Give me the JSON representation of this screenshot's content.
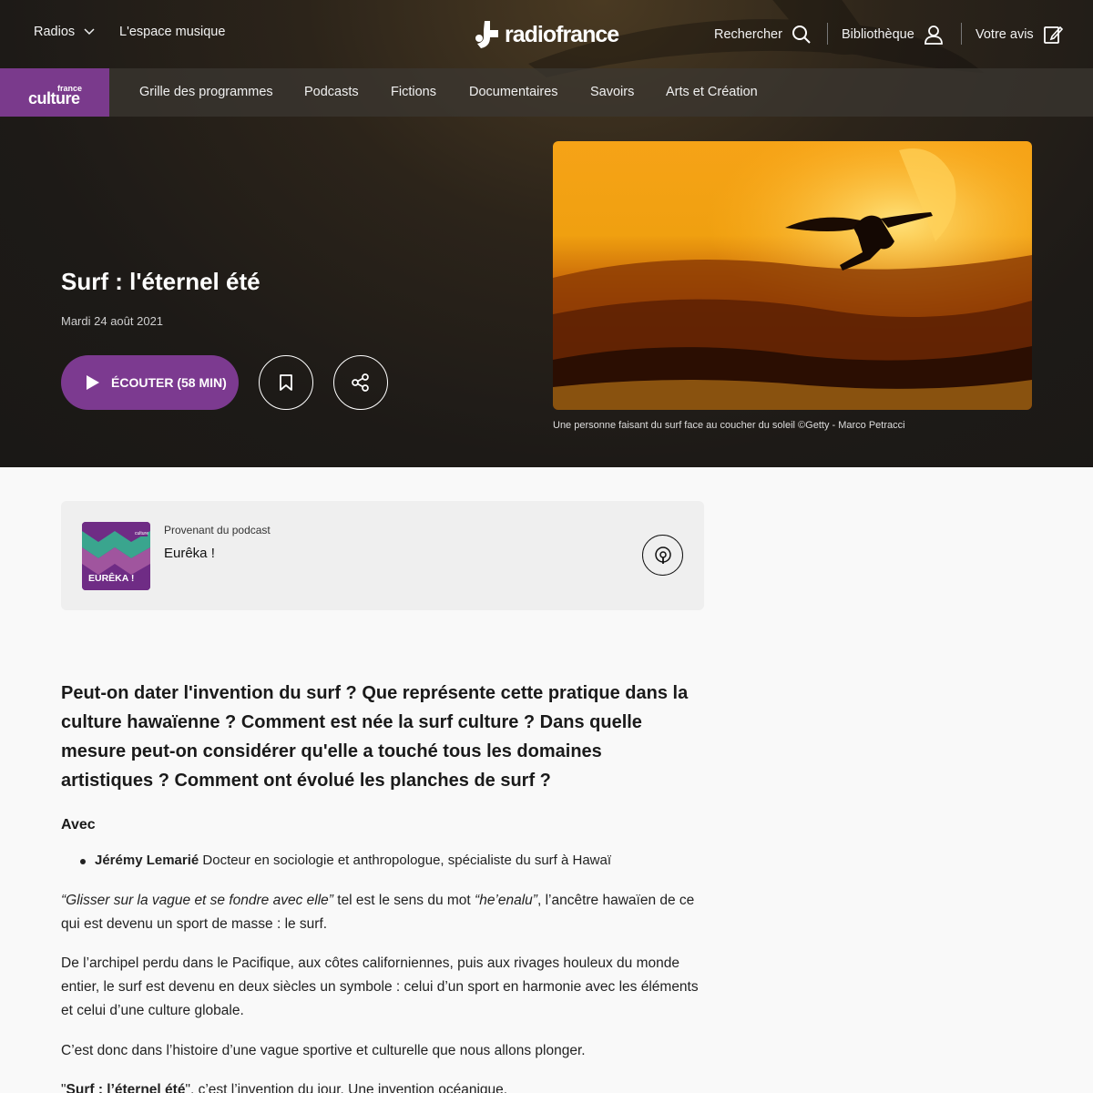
{
  "topbar": {
    "radios": "Radios",
    "espace_musique": "L'espace musique",
    "logo": "radiofrance",
    "search": "Rechercher",
    "library": "Bibliothèque",
    "feedback": "Votre avis"
  },
  "nav": {
    "station_small": "france",
    "station_big": "culture",
    "items": [
      "Grille des programmes",
      "Podcasts",
      "Fictions",
      "Documentaires",
      "Savoirs",
      "Arts et Création"
    ]
  },
  "episode": {
    "title": "Surf : l'éternel été",
    "date": "Mardi 24 août 2021",
    "listen_label": "ÉCOUTER (58 MIN)",
    "image_caption": "Une personne faisant du surf face au coucher du soleil ©Getty - Marco Petracci"
  },
  "podcast": {
    "from_label": "Provenant du podcast",
    "name": "Eurêka !",
    "thumb_label": "EURÊKA !",
    "thumb_brand": "culture"
  },
  "article": {
    "lead": "Peut-on dater l'invention du surf ? Que représente cette pratique dans la culture hawaïenne ? Comment est née la surf culture ? Dans quelle mesure peut-on considérer qu'elle a touché tous les domaines artistiques ? Comment ont évolué les planches de surf ?",
    "avec_label": "Avec",
    "guest_name": "Jérémy Lemarié",
    "guest_desc": "Docteur en sociologie et anthropologue, spécialiste du surf à Hawaï",
    "p1_quote": "“Glisser sur la vague et se fondre avec elle”",
    "p1_mid": " tel est le sens du mot ",
    "p1_word": "“he’enalu”",
    "p1_end": ", l’ancêtre hawaïen de ce qui est devenu un sport de masse : le surf.",
    "p2": "De l’archipel perdu dans le Pacifique, aux côtes californiennes, puis aux rivages houleux du monde entier, le surf est devenu en deux siècles un symbole : celui d’un sport en harmonie avec les éléments et celui d’une culture globale.",
    "p3": "C’est donc dans l’histoire d’une vague sportive et culturelle que nous allons plonger.",
    "p4_open": "\"",
    "p4_bold": "Surf : l’éternel été",
    "p4_rest": "\", c’est l’invention du jour. Une invention océanique."
  },
  "colors": {
    "brand_purple": "#7c3a90",
    "hero_bg": "#1d1a17",
    "page_bg": "#f9f9f9"
  }
}
